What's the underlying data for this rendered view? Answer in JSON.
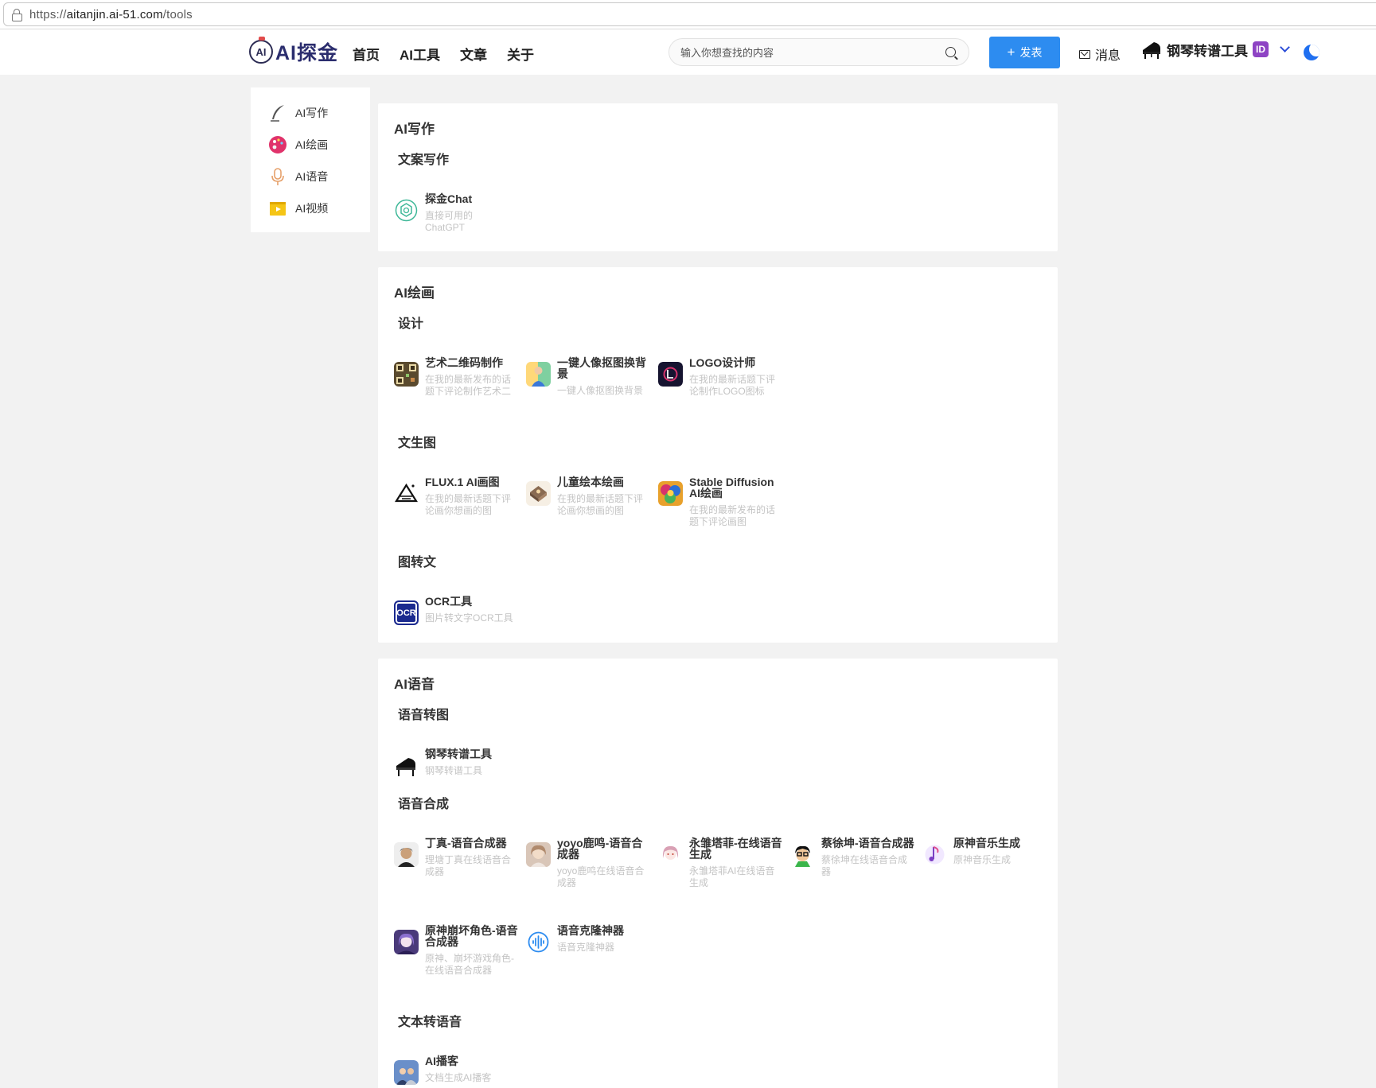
{
  "browser": {
    "url_prefix": "https://",
    "url_host": "aitanjin.ai-51.com",
    "url_path": "/tools"
  },
  "header": {
    "logo_badge": "AI",
    "logo_text": "AI探金",
    "nav": [
      "首页",
      "AI工具",
      "文章",
      "关于"
    ],
    "search_placeholder": "输入你想查找的内容",
    "publish_label": "发表",
    "messages_label": "消息",
    "user_name": "钢琴转谱工具",
    "user_badge": "ID"
  },
  "sidebar": {
    "items": [
      {
        "label": "AI写作",
        "icon": "quill-icon"
      },
      {
        "label": "AI绘画",
        "icon": "palette-icon"
      },
      {
        "label": "AI语音",
        "icon": "microphone-icon"
      },
      {
        "label": "AI视频",
        "icon": "video-icon"
      }
    ]
  },
  "sections": [
    {
      "title": "AI写作",
      "groups": [
        {
          "title": "文案写作",
          "tools": [
            {
              "name": "探金Chat",
              "desc": "直接可用的ChatGPT",
              "icon": "chatgpt-icon"
            }
          ]
        }
      ]
    },
    {
      "title": "AI绘画",
      "groups": [
        {
          "title": "设计",
          "tools": [
            {
              "name": "艺术二维码制作",
              "desc": "在我的最新发布的话题下评论制作艺术二",
              "icon": "qr-art-icon"
            },
            {
              "name": "一键人像抠图换背景",
              "desc": "一键人像抠图换背景",
              "icon": "portrait-cutout-icon"
            },
            {
              "name": "LOGO设计师",
              "desc": "在我的最新话题下评论制作LOGO图标",
              "icon": "logo-designer-icon"
            }
          ]
        },
        {
          "title": "文生图",
          "tools": [
            {
              "name": "FLUX.1 AI画图",
              "desc": "在我的最新话题下评论画你想画的图",
              "icon": "flux-icon"
            },
            {
              "name": "儿童绘本绘画",
              "desc": "在我的最新话题下评论画你想画的图",
              "icon": "picture-book-icon"
            },
            {
              "name": "Stable Diffusion AI绘画",
              "desc": "在我的最新发布的话题下评论画图",
              "icon": "stable-diffusion-icon"
            }
          ]
        },
        {
          "title": "图转文",
          "tools": [
            {
              "name": "OCR工具",
              "desc": "图片转文字OCR工具",
              "icon": "ocr-icon",
              "icon_text": "OCR"
            }
          ]
        }
      ]
    },
    {
      "title": "AI语音",
      "groups": [
        {
          "title": "语音转图",
          "tools": [
            {
              "name": "钢琴转谱工具",
              "desc": "钢琴转谱工具",
              "icon": "piano-icon"
            }
          ]
        },
        {
          "title": "语音合成",
          "tools": [
            {
              "name": "丁真-语音合成器",
              "desc": "理塘丁真在线语音合成器",
              "icon": "avatar-dingzhen-icon"
            },
            {
              "name": "yoyo鹿鸣-语音合成器",
              "desc": "yoyo鹿鸣在线语音合成器",
              "icon": "avatar-yoyo-icon"
            },
            {
              "name": "永雏塔菲-在线语音生成",
              "desc": "永雏塔菲AI在线语音生成",
              "icon": "avatar-taffy-icon"
            },
            {
              "name": "蔡徐坤-语音合成器",
              "desc": "蔡徐坤在线语音合成器",
              "icon": "avatar-cxk-icon"
            },
            {
              "name": "原神音乐生成",
              "desc": "原神音乐生成",
              "icon": "music-note-icon"
            },
            {
              "name": "原神崩坏角色-语音合成器",
              "desc": "原神、崩坏游戏角色-在线语音合成器",
              "icon": "avatar-genshin-icon"
            },
            {
              "name": "语音克隆神器",
              "desc": "语音克隆神器",
              "icon": "waveform-icon"
            }
          ]
        },
        {
          "title": "文本转语音",
          "tools": [
            {
              "name": "AI播客",
              "desc": "文档生成AI播客",
              "icon": "podcast-icon"
            }
          ]
        }
      ]
    }
  ],
  "colors": {
    "primary": "#2d8cf0",
    "logo": "#2b2d6e",
    "moon": "#1f6ff0",
    "badge": "#8e44c4"
  }
}
